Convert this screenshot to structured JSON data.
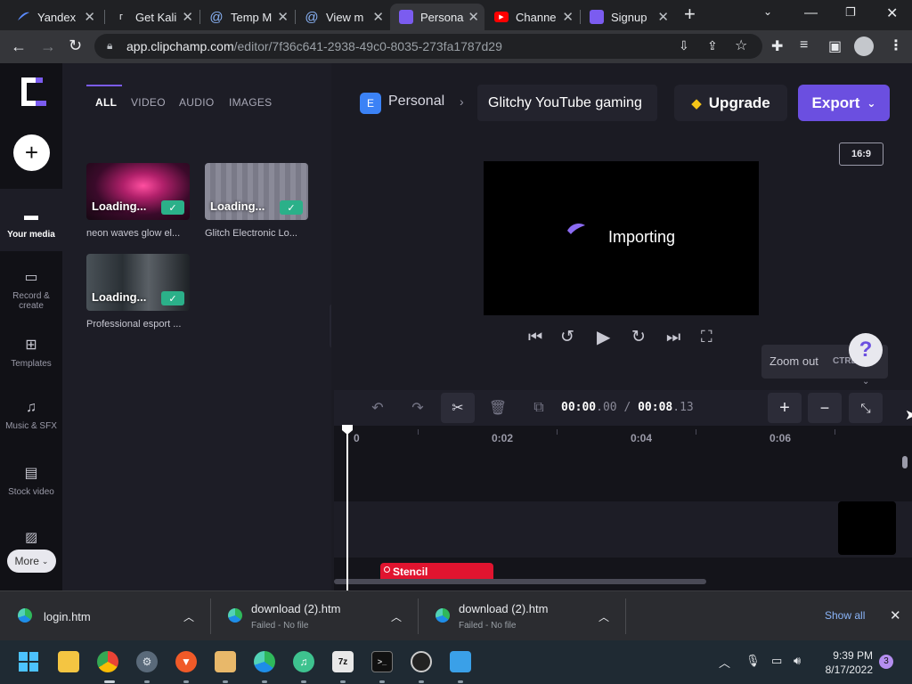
{
  "browser": {
    "tabs": [
      {
        "title": "Yandex",
        "fav": "yandex-icon"
      },
      {
        "title": "Get Kali",
        "fav": "kali-icon"
      },
      {
        "title": "Temp M",
        "fav": "at-icon"
      },
      {
        "title": "View m",
        "fav": "at-icon"
      },
      {
        "title": "Persona",
        "fav": "clipchamp-icon",
        "active": true
      },
      {
        "title": "Channe",
        "fav": "youtube-icon"
      },
      {
        "title": "Signup",
        "fav": "clipchamp-icon"
      }
    ],
    "url_host": "app.clipchamp.com",
    "url_path": "/editor/7f36c641-2938-49c0-8035-273fa1787d29"
  },
  "sidebar": {
    "items": [
      {
        "label": "Your media",
        "icon": "folder-icon",
        "active": true
      },
      {
        "label": "Record & create",
        "icon": "camera-icon"
      },
      {
        "label": "Templates",
        "icon": "templates-icon"
      },
      {
        "label": "Music & SFX",
        "icon": "music-icon"
      },
      {
        "label": "Stock video",
        "icon": "film-icon"
      }
    ],
    "more_label": "More"
  },
  "media": {
    "tabs": [
      "ALL",
      "VIDEO",
      "AUDIO",
      "IMAGES"
    ],
    "loading_label": "Loading...",
    "items": [
      {
        "caption": "neon waves glow el..."
      },
      {
        "caption": "Glitch Electronic Lo..."
      },
      {
        "caption": "Professional esport ..."
      }
    ]
  },
  "header": {
    "workspace_initial": "E",
    "workspace": "Personal",
    "project_title": "Glitchy YouTube gaming",
    "upgrade_label": "Upgrade",
    "export_label": "Export"
  },
  "preview": {
    "aspect": "16:9",
    "status": "Importing"
  },
  "zoom_tooltip": {
    "text": "Zoom out",
    "shortcut": "CTRL"
  },
  "help_label": "?",
  "timeline": {
    "time_current_main": "00:00",
    "time_current_frac": ".00",
    "time_separator": "/",
    "time_total_main": "00:08",
    "time_total_frac": ".13",
    "ruler_marks": [
      "0",
      "0:02",
      "0:04",
      "0:06"
    ],
    "clip_label": "Stencil"
  },
  "downloads": {
    "items": [
      {
        "name": "login.htm",
        "status": ""
      },
      {
        "name": "download (2).htm",
        "status": "Failed - No file"
      },
      {
        "name": "download (2).htm",
        "status": "Failed - No file"
      }
    ],
    "show_all": "Show all"
  },
  "taskbar": {
    "time": "9:39 PM",
    "date": "8/17/2022",
    "notifications": "3"
  },
  "colors": {
    "accent": "#6b4fe0",
    "check": "#2bb089",
    "clip": "#e0142f"
  }
}
